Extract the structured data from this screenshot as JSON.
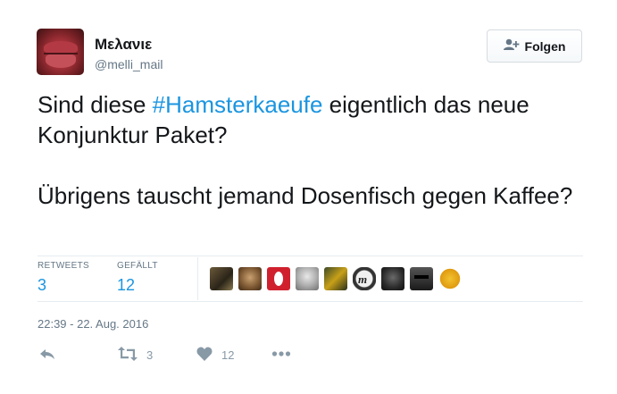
{
  "user": {
    "display_name": "Μελανιε",
    "handle": "@melli_mail"
  },
  "follow_button": {
    "label": "Folgen"
  },
  "tweet": {
    "line1_prefix": "Sind diese ",
    "hashtag": "#Hamsterkaeufe",
    "line1_suffix": " eigentlich das neue Konjunktur Paket?",
    "paragraph2": "Übrigens tauscht jemand Dosenfisch gegen Kaffee?"
  },
  "stats": {
    "retweets_label": "RETWEETS",
    "retweets_value": "3",
    "likes_label": "GEFÄLLT",
    "likes_value": "12"
  },
  "timestamp": "22:39 - 22. Aug. 2016",
  "actions": {
    "retweet_count": "3",
    "like_count": "12"
  },
  "colors": {
    "link": "#1b95e0",
    "muted": "#657786",
    "text": "#14171a"
  },
  "icons": [
    "follow-user-icon",
    "reply-icon",
    "retweet-icon",
    "heart-icon",
    "more-icon"
  ]
}
